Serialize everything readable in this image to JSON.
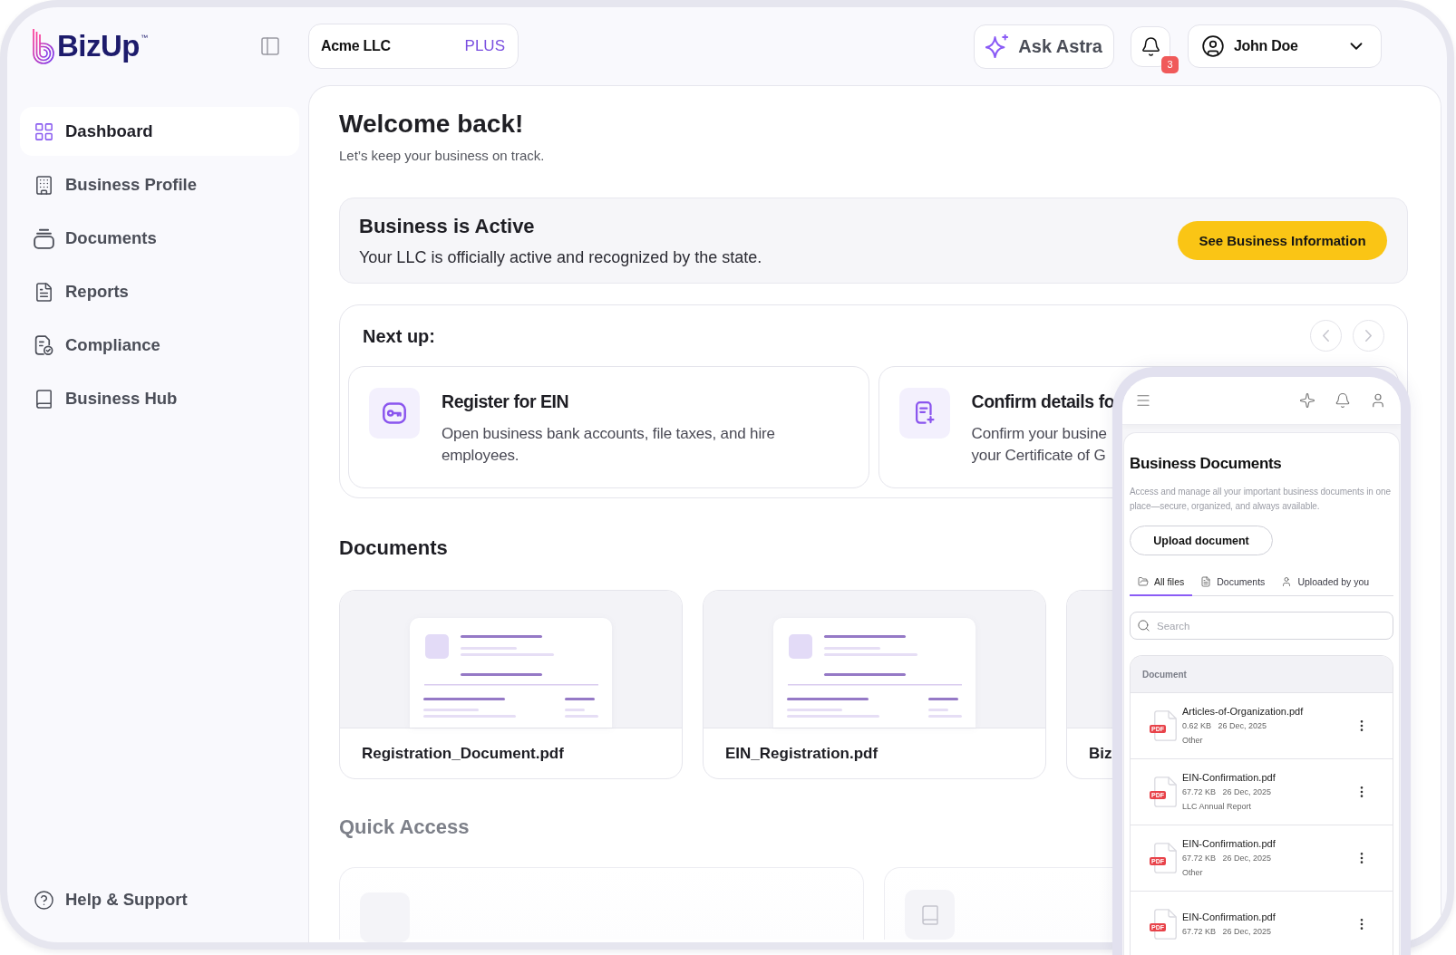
{
  "brand": {
    "name": "BizUp",
    "trademark": "™"
  },
  "business_selector": {
    "name": "Acme LLC",
    "plan": "PLUS"
  },
  "header": {
    "assistant_button": "Ask Astra",
    "notifications": {
      "count": "3"
    },
    "user": {
      "name": "John Doe"
    }
  },
  "sidebar": {
    "items": [
      {
        "label": "Dashboard",
        "selected": true
      },
      {
        "label": "Business Profile",
        "selected": false
      },
      {
        "label": "Documents",
        "selected": false
      },
      {
        "label": "Reports",
        "selected": false
      },
      {
        "label": "Compliance",
        "selected": false
      },
      {
        "label": "Business Hub",
        "selected": false
      }
    ],
    "footer_item": {
      "label": "Help & Support"
    }
  },
  "welcome": {
    "title": "Welcome back!",
    "subtitle": "Let’s keep your business on track."
  },
  "status_card": {
    "title": "Business is Active",
    "text": "Your LLC is officially active and recognized by the state.",
    "button": "See Business Information"
  },
  "next_up": {
    "title": "Next up:",
    "tasks": [
      {
        "title": "Register for EIN",
        "description_lines": [
          "Open business bank accounts, file taxes, and hire",
          "employees."
        ]
      },
      {
        "title": "Confirm details fo",
        "description_lines": [
          "Confirm your busine",
          "your Certificate of G"
        ]
      }
    ]
  },
  "documents": {
    "title": "Documents",
    "files": [
      {
        "name": "Registration_Document.pdf"
      },
      {
        "name": "EIN_Registration.pdf"
      },
      {
        "name": "Biz"
      }
    ]
  },
  "quick_access": {
    "title": "Quick Access"
  },
  "mobile_preview": {
    "title": "Business Documents",
    "description": "Access and manage all your important business documents in one place—secure, organized, and always available.",
    "upload_button": "Upload document",
    "tabs": [
      {
        "label": "All files",
        "selected": true
      },
      {
        "label": "Documents",
        "selected": false
      },
      {
        "label": "Uploaded by you",
        "selected": false
      }
    ],
    "search": {
      "placeholder": "Search"
    },
    "table": {
      "column": "Document",
      "rows": [
        {
          "badge": "PDF",
          "name": "Articles-of-Organization.pdf",
          "size": "0.62 KB",
          "date": "26 Dec, 2025",
          "category": "Other"
        },
        {
          "badge": "PDF",
          "name": "EIN-Confirmation.pdf",
          "size": "67.72 KB",
          "date": "26 Dec, 2025",
          "category": "LLC Annual Report"
        },
        {
          "badge": "PDF",
          "name": "EIN-Confirmation.pdf",
          "size": "67.72 KB",
          "date": "26 Dec, 2025",
          "category": "Other"
        },
        {
          "badge": "PDF",
          "name": "EIN-Confirmation.pdf",
          "size": "67.72 KB",
          "date": "26 Dec, 2025"
        }
      ]
    }
  }
}
